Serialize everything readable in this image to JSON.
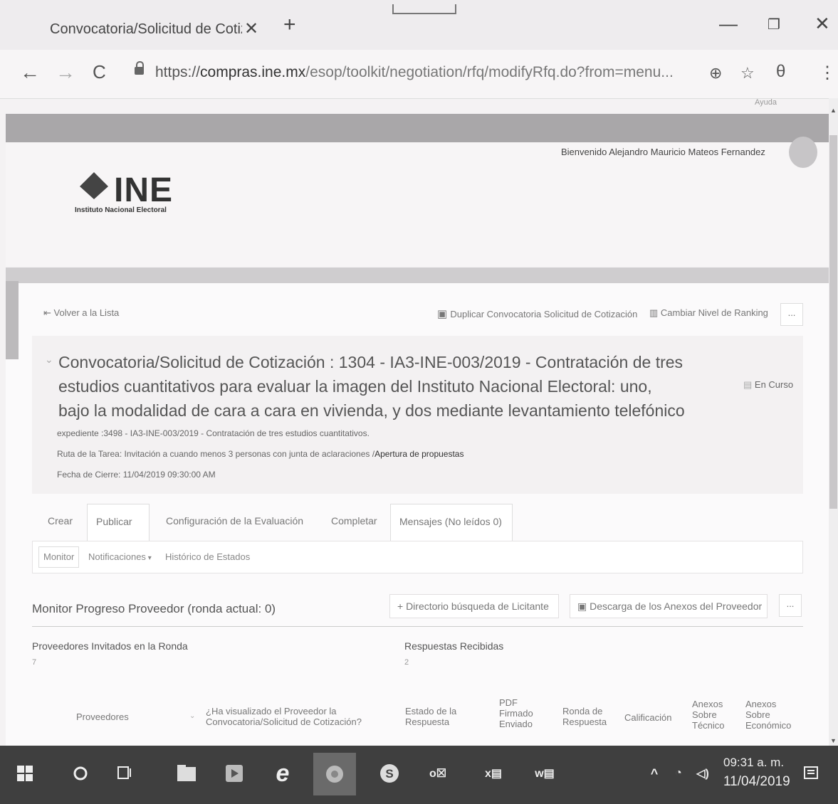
{
  "browser": {
    "tab_title": "Convocatoria/Solicitud de Cotiz",
    "tab_close": "✕",
    "new_tab": "+",
    "url_scheme": "https://",
    "url_host": "compras.ine.mx",
    "url_path": "/esop/toolkit/negotiation/rfq/modifyRfq.do?from=menu...",
    "window": {
      "minimize": "—",
      "restore": "❐",
      "close": "✕"
    },
    "nav": {
      "back": "←",
      "forward": "→",
      "reload": "C"
    },
    "toolbar": {
      "zoom": "⊕",
      "star": "☆",
      "profile": "θ",
      "menu": "⋮"
    }
  },
  "header": {
    "help": "Ayuda",
    "welcome": "Bienvenido Alejandro Mauricio Mateos Fernandez",
    "logo_text": "INE",
    "logo_sub": "Instituto Nacional Electoral"
  },
  "actions": {
    "back_to_list": "Volver a la Lista",
    "duplicate": "Duplicar Convocatoria Solicitud de Cotización",
    "change_ranking": "Cambiar Nivel de Ranking",
    "more": "..."
  },
  "summary": {
    "title": "Convocatoria/Solicitud de Cotización : 1304 - IA3-INE-003/2019 - Contratación de tres estudios cuantitativos para evaluar la imagen del Instituto Nacional Electoral: uno, bajo la modalidad de cara a cara en vivienda, y dos mediante levantamiento telefónico",
    "status": "En Curso",
    "expediente": "expediente :3498 - IA3-INE-003/2019 - Contratación de tres estudios cuantitativos.",
    "route_label": "Ruta de la Tarea: Invitación a cuando menos 3 personas con junta de aclaraciones /",
    "route_value": "Apertura de propuestas",
    "close_date": "Fecha de Cierre: 11/04/2019 09:30:00 AM"
  },
  "tabs": [
    "Crear",
    "Publicar",
    "Configuración de la Evaluación",
    "Completar",
    "Mensajes (No leídos 0)"
  ],
  "subtabs": [
    "Monitor",
    "Notificaciones",
    "Histórico de Estados"
  ],
  "monitor": {
    "title": "Monitor Progreso Proveedor (ronda actual: 0)",
    "directory_button": "+ Directorio búsqueda de Licitante",
    "download_button": "Descarga de los Anexos del Proveedor",
    "invited_label": "Proveedores Invitados en la Ronda",
    "invited_value": "7",
    "received_label": "Respuestas Recibidas",
    "received_value": "2"
  },
  "table_headers": {
    "proveedores": "Proveedores",
    "visualizado": "¿Ha visualizado el Proveedor la Convocatoria/Solicitud de Cotización?",
    "estado": "Estado de la Respuesta",
    "pdf": "PDF Firmado Enviado",
    "ronda": "Ronda de Respuesta",
    "calificacion": "Calificación",
    "anexos_tecnico": "Anexos Sobre Técnico",
    "anexos_economico": "Anexos Sobre Económico"
  },
  "taskbar": {
    "time": "09:31 a. m.",
    "date": "11/04/2019"
  }
}
